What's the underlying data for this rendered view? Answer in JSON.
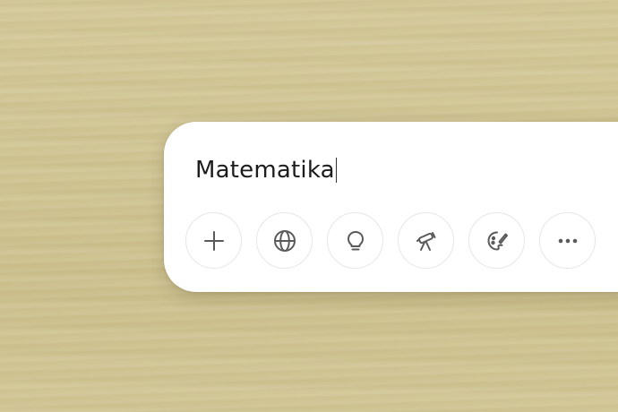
{
  "composer": {
    "input_value": "Matematika"
  },
  "tools": [
    {
      "icon": "plus-icon"
    },
    {
      "icon": "globe-icon"
    },
    {
      "icon": "lightbulb-icon"
    },
    {
      "icon": "telescope-icon"
    },
    {
      "icon": "palette-icon"
    },
    {
      "icon": "more-icon"
    }
  ],
  "colors": {
    "icon": "#5a5a5a",
    "panel": "#ffffff",
    "background": "#d0c594"
  }
}
